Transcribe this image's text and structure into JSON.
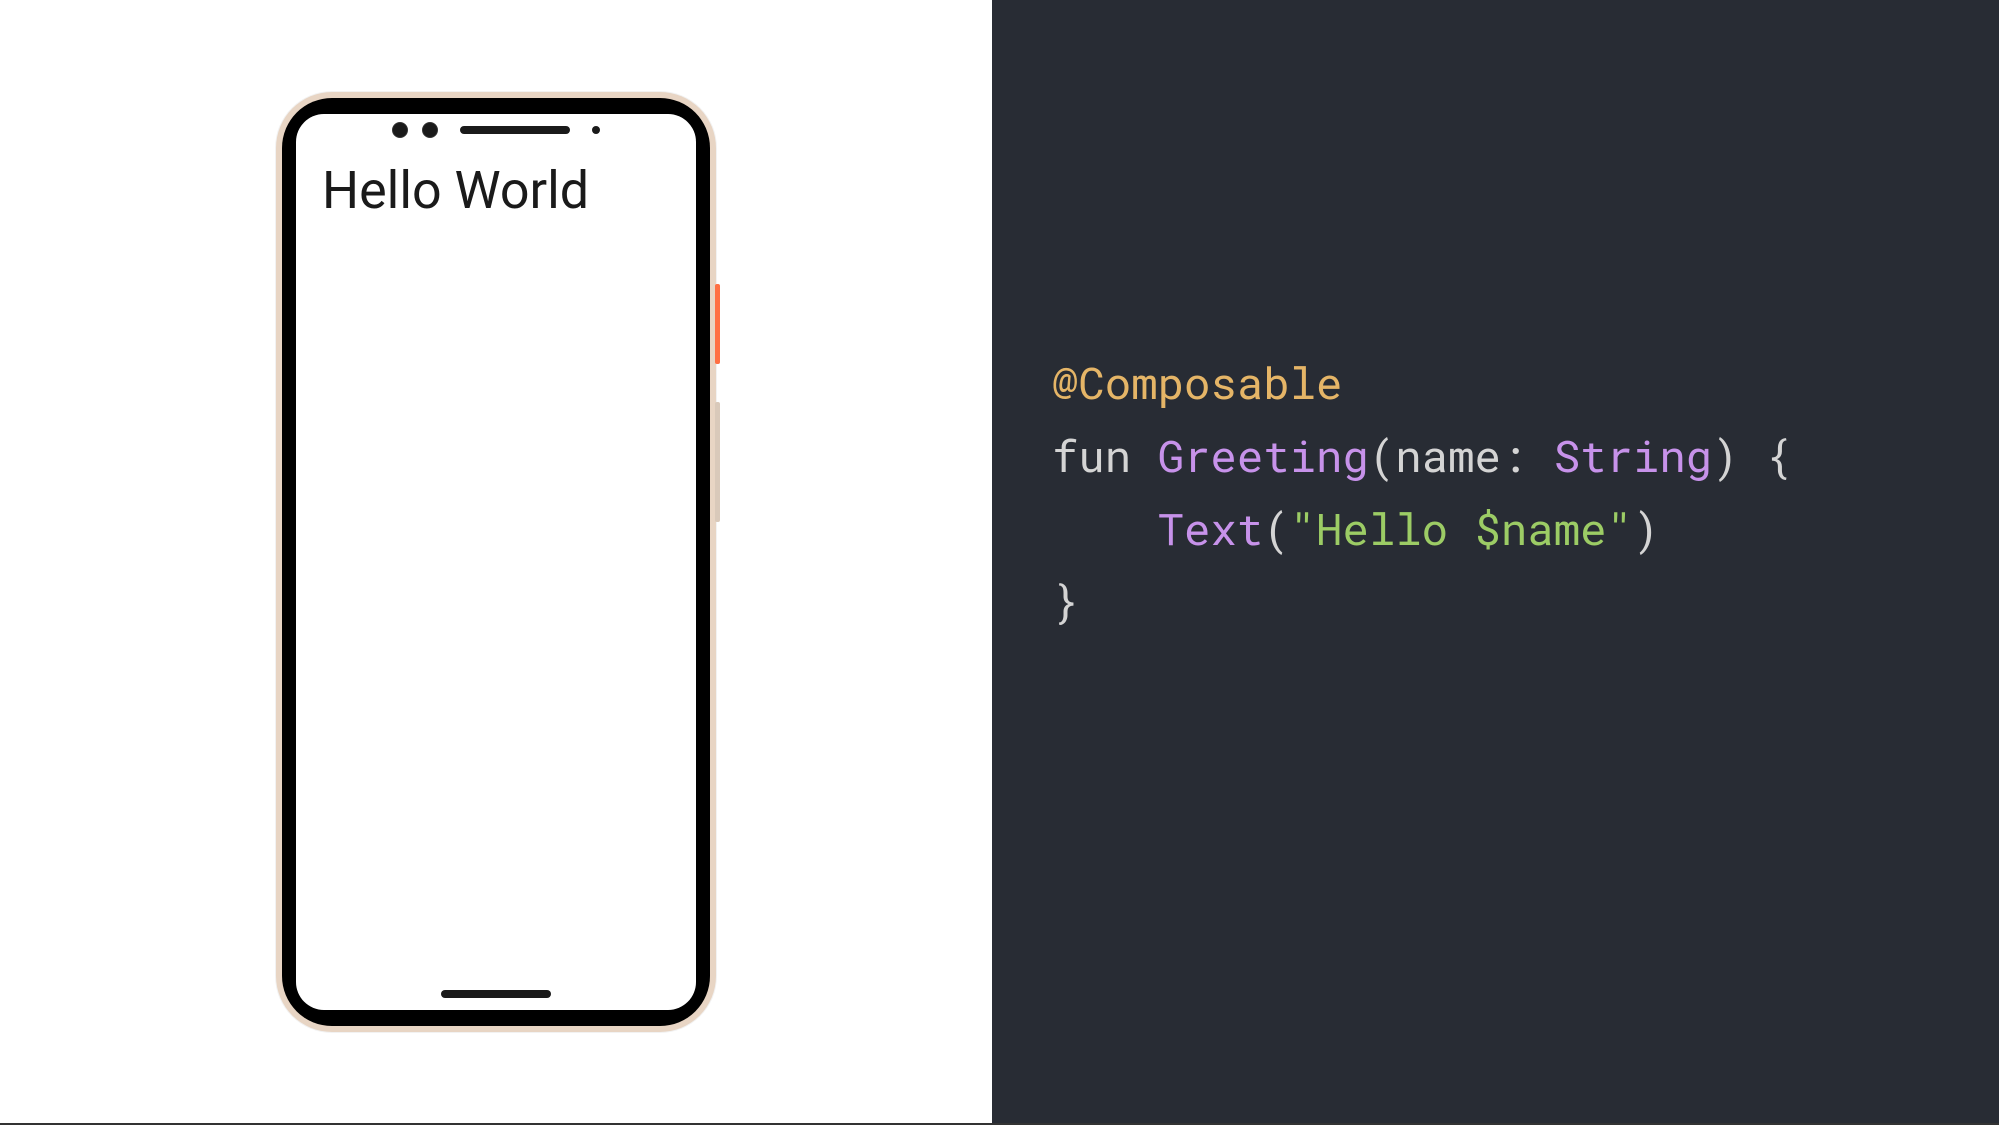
{
  "phone": {
    "screen_text": "Hello World"
  },
  "code": {
    "annotation": "@Composable",
    "keyword_fun": "fun",
    "func_name": "Greeting",
    "paren_open": "(",
    "param_name": "name",
    "colon": ":",
    "type_name": "String",
    "paren_close": ")",
    "brace_open": " {",
    "call_name": "Text",
    "call_paren_open": "(",
    "string_literal": "\"Hello $name\"",
    "call_paren_close": ")",
    "brace_close": "}"
  }
}
